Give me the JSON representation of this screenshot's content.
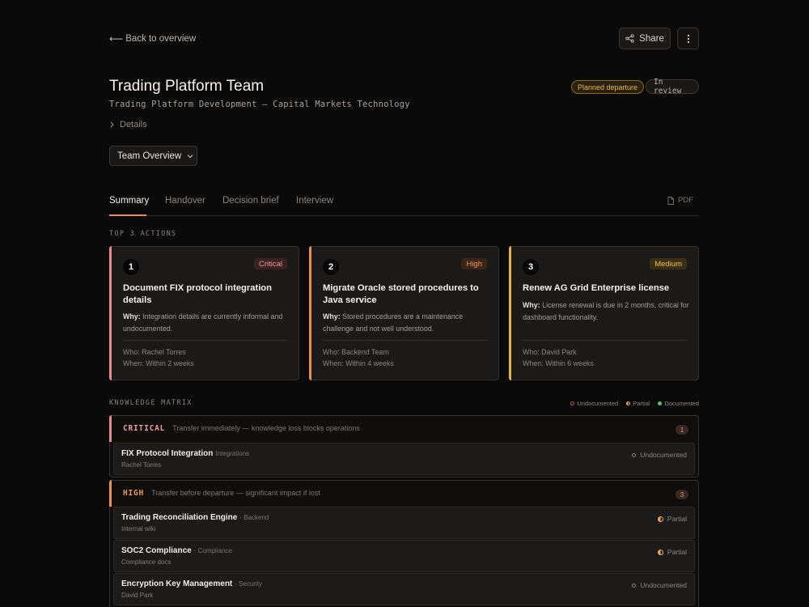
{
  "nav": {
    "back_label": "Back to overview",
    "share_label": "Share"
  },
  "header": {
    "title": "Trading Platform Team",
    "subtitle": "Trading Platform Development — Capital Markets Technology",
    "badge_planned": "Planned departure",
    "badge_review": "In review",
    "details_label": "Details",
    "dropdown_value": "Team Overview"
  },
  "tabs": [
    {
      "label": "Summary",
      "active": true
    },
    {
      "label": "Handover"
    },
    {
      "label": "Decision brief"
    },
    {
      "label": "Interview"
    }
  ],
  "pdf_label": "PDF",
  "actions_label": "TOP 3 ACTIONS",
  "actions": [
    {
      "num": "1",
      "priority": "Critical",
      "color": "#e8898c",
      "title": "Document FIX protocol integration details",
      "why_label": "Why:",
      "why": "Integration details are currently informal and undocumented.",
      "who": "Who: Rachel Torres",
      "when": "When: Within 2 weeks"
    },
    {
      "num": "2",
      "priority": "High",
      "color": "#e7924f",
      "title": "Migrate Oracle stored procedures to Java service",
      "why_label": "Why:",
      "why": "Stored procedures are a maintenance challenge and not well understood.",
      "who": "Who: Backend Team",
      "when": "When: Within 4 weeks"
    },
    {
      "num": "3",
      "priority": "Medium",
      "color": "#e5b23c",
      "title": "Renew AG Grid Enterprise license",
      "why_label": "Why:",
      "why": "License renewal is due in 2 months, critical for dashboard functionality.",
      "who": "Who: David Park",
      "when": "When: Within 6 weeks"
    }
  ],
  "matrix_label": "KNOWLEDGE MATRIX",
  "legend": {
    "undocumented": "Undocumented",
    "partial": "Partial",
    "documented": "Documented"
  },
  "groups": [
    {
      "name": "CRITICAL",
      "color": "#e8898c",
      "desc": "Transfer immediately — knowledge loss blocks operations",
      "count": "1",
      "rows": [
        {
          "title": "FIX Protocol Integration",
          "category": "Integrations",
          "owner": "Rachel Torres",
          "status": "Undocumented"
        }
      ]
    },
    {
      "name": "HIGH",
      "color": "#e7924f",
      "desc": "Transfer before departure — significant impact if lost",
      "count": "3",
      "rows": [
        {
          "title": "Trading Reconciliation Engine",
          "category": "· Backend",
          "owner": "Internal wiki",
          "status": "Partial"
        },
        {
          "title": "SOC2 Compliance",
          "category": "· Compliance",
          "owner": "Compliance docs",
          "status": "Partial"
        },
        {
          "title": "Encryption Key Management",
          "category": "· Security",
          "owner": "David Park",
          "status": "Undocumented"
        }
      ]
    }
  ]
}
